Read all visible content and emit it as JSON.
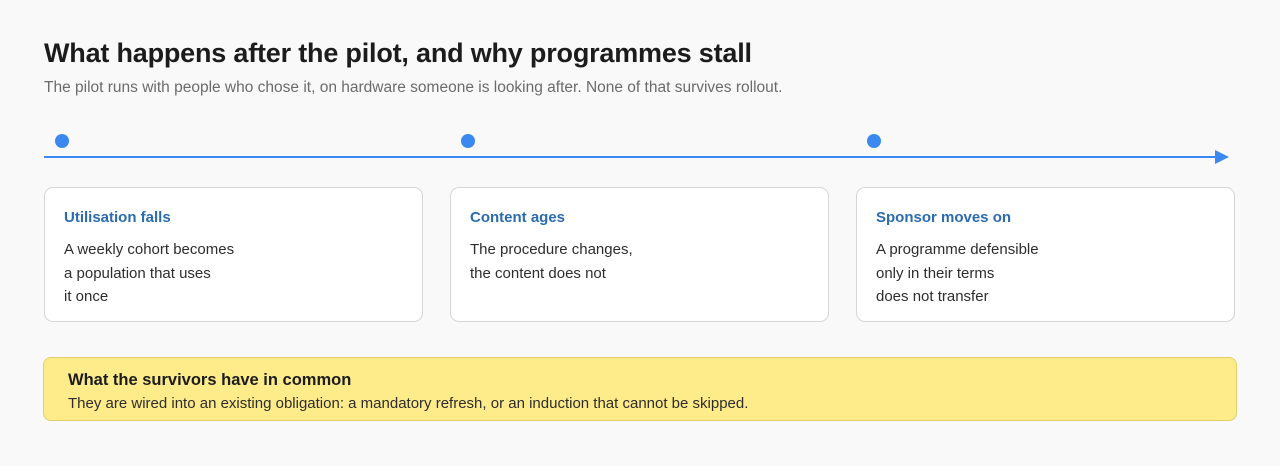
{
  "header": {
    "title": "What happens after the pilot, and why programmes stall",
    "subtitle": "The pilot runs with people who chose it, on hardware someone is looking after. None of that survives rollout."
  },
  "timeline": {
    "color": "#3b89f0",
    "stages": [
      {
        "title": "Utilisation falls",
        "lines": [
          "A weekly cohort becomes",
          "a population that uses",
          "it once"
        ]
      },
      {
        "title": "Content ages",
        "lines": [
          "The procedure changes,",
          "the content does not"
        ]
      },
      {
        "title": "Sponsor moves on",
        "lines": [
          "A programme defensible",
          "only in their terms",
          "does not transfer"
        ]
      }
    ]
  },
  "callout": {
    "title": "What the survivors have in common",
    "body": "They are wired into an existing obligation: a mandatory refresh, or an induction that cannot be skipped.",
    "background": "#feeb8a"
  }
}
